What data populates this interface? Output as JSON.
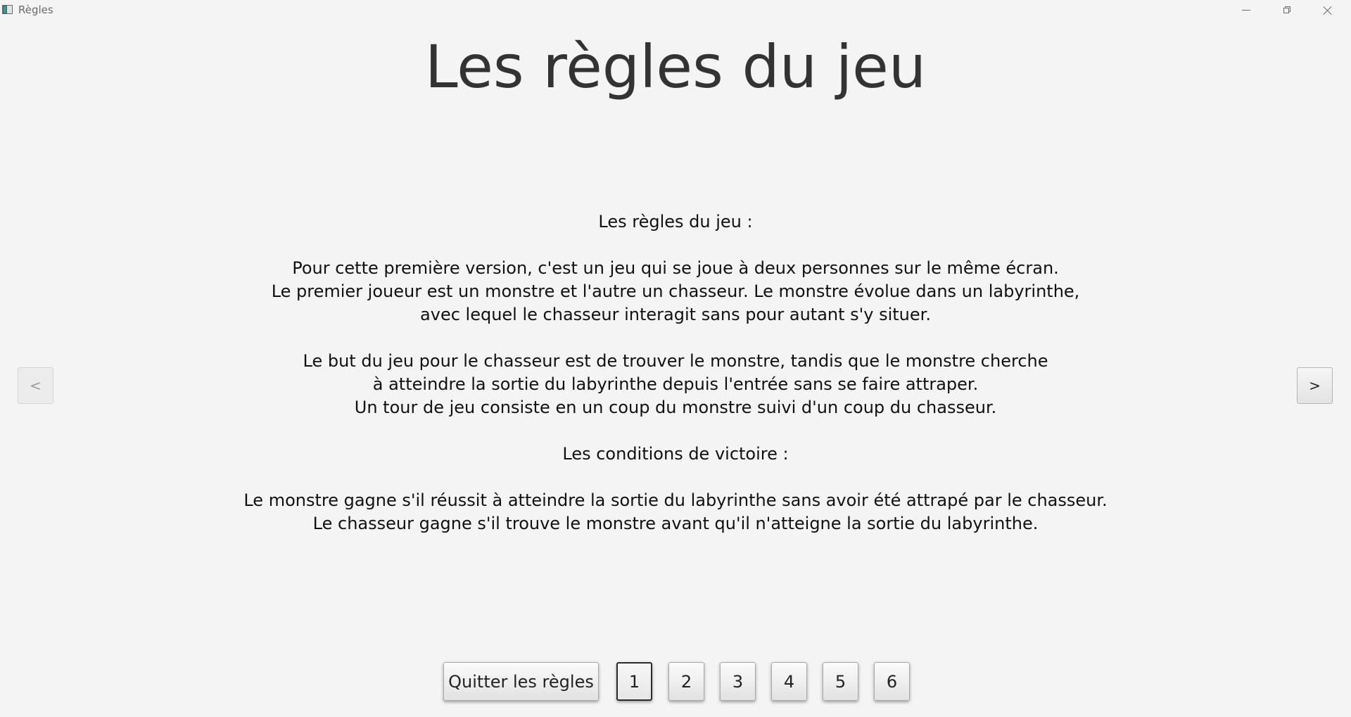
{
  "window": {
    "title": "Règles",
    "icon": "app-window-icon"
  },
  "page_title": "Les règles du jeu",
  "rules": {
    "heading": "Les règles du jeu :",
    "para1": [
      "Pour cette première version, c'est un jeu qui se joue à deux personnes sur le même écran.",
      "Le premier joueur est un monstre et l'autre un chasseur. Le monstre évolue dans un labyrinthe,",
      "avec lequel le chasseur interagit sans pour autant s'y situer."
    ],
    "para2": [
      "Le but du jeu pour le chasseur est de trouver le monstre, tandis que le monstre cherche",
      "à atteindre la sortie du labyrinthe depuis l'entrée sans se faire attraper.",
      "Un tour de jeu consiste en un coup du monstre suivi d'un coup du chasseur."
    ],
    "victory_heading": "Les conditions de victoire :",
    "para3": [
      "Le monstre gagne s'il réussit à atteindre la sortie du labyrinthe sans avoir été attrapé par le chasseur.",
      "Le chasseur gagne s'il trouve le monstre avant qu'il n'atteigne la sortie du labyrinthe."
    ]
  },
  "nav": {
    "prev_label": "<",
    "next_label": ">",
    "prev_disabled": true
  },
  "footer": {
    "quit_label": "Quitter les règles",
    "pages": [
      "1",
      "2",
      "3",
      "4",
      "5",
      "6"
    ],
    "current_page": "1"
  }
}
